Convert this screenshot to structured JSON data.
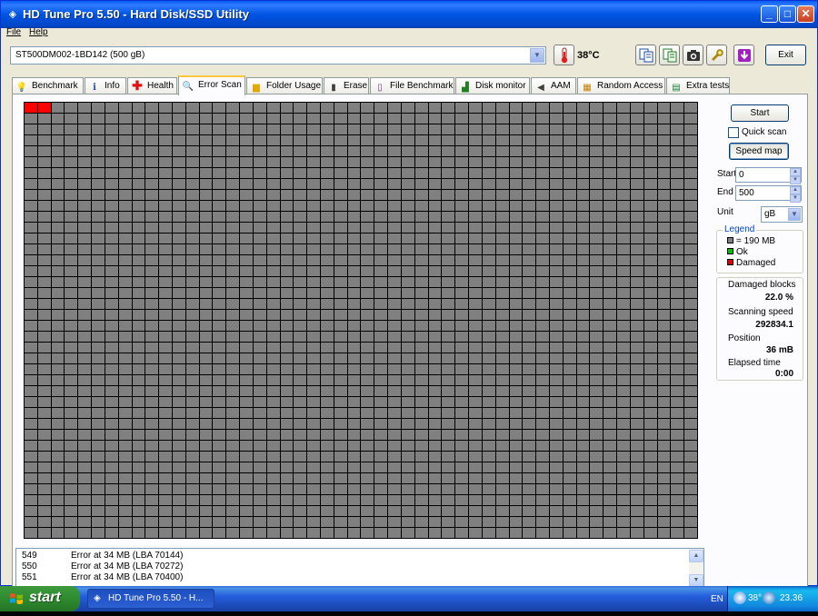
{
  "window": {
    "title": "HD Tune Pro 5.50 - Hard Disk/SSD Utility",
    "minimize": "_",
    "maximize": "□",
    "close": "✕"
  },
  "menu": {
    "file": "File",
    "help": "Help"
  },
  "toolbar": {
    "drive": "ST500DM002-1BD142 (500 gB)",
    "temperature": "38°C",
    "exit_label": "Exit"
  },
  "tabs": [
    {
      "label": "Benchmark",
      "icon": "light-bulb-icon"
    },
    {
      "label": "Info",
      "icon": "info-icon"
    },
    {
      "label": "Health",
      "icon": "health-cross-icon"
    },
    {
      "label": "Error Scan",
      "icon": "magnifier-icon"
    },
    {
      "label": "Folder Usage",
      "icon": "folder-icon"
    },
    {
      "label": "Erase",
      "icon": "trash-icon"
    },
    {
      "label": "File Benchmark",
      "icon": "file-icon"
    },
    {
      "label": "Disk monitor",
      "icon": "monitor-chart-icon"
    },
    {
      "label": "AAM",
      "icon": "speaker-icon"
    },
    {
      "label": "Random Access",
      "icon": "random-access-icon"
    },
    {
      "label": "Extra tests",
      "icon": "extra-tests-icon"
    }
  ],
  "active_tab": "Error Scan",
  "scan": {
    "start_button": "Start",
    "quick_scan_label": "Quick scan",
    "quick_scan_checked": false,
    "speed_map_button": "Speed map",
    "start_label": "Start",
    "start_value": "0",
    "end_label": "End",
    "end_value": "500",
    "unit_label": "Unit",
    "unit_value": "gB"
  },
  "grid": {
    "columns": 50,
    "rows": 40,
    "damaged_blocks": 2,
    "colors": {
      "untested": "#808080",
      "ok": "#00C000",
      "damaged": "#FF0000"
    }
  },
  "legend": {
    "title": "Legend",
    "block_size": "= 190 MB",
    "ok": "Ok",
    "damaged": "Damaged"
  },
  "stats": {
    "damaged_blocks_label": "Damaged blocks",
    "damaged_blocks_value": "22.0 %",
    "scanning_speed_label": "Scanning speed",
    "scanning_speed_value": "292834.1",
    "position_label": "Position",
    "position_value": "36 mB",
    "elapsed_label": "Elapsed time",
    "elapsed_value": "0:00"
  },
  "log": [
    {
      "num": "549",
      "text": "Error at 34 MB (LBA 70144)"
    },
    {
      "num": "550",
      "text": "Error at 34 MB (LBA 70272)"
    },
    {
      "num": "551",
      "text": "Error at 34 MB (LBA 70400)"
    }
  ],
  "taskbar": {
    "start": "start",
    "task": "HD Tune Pro 5.50 - H...",
    "language": "EN",
    "tray_temp": "38°",
    "clock": "23.36"
  }
}
